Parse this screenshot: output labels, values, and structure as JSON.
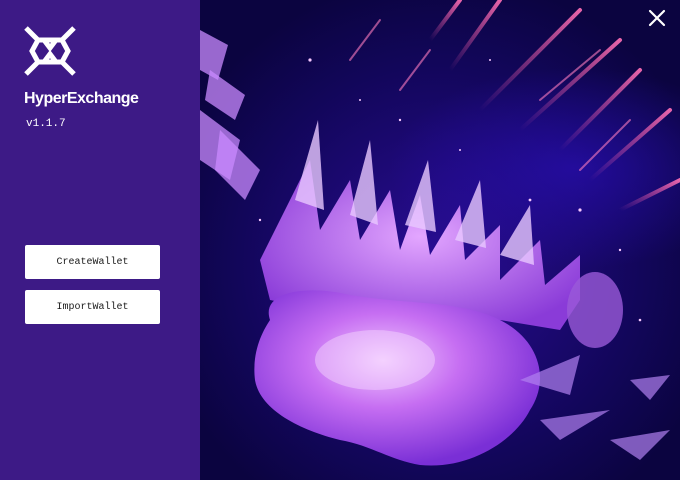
{
  "app": {
    "brand_name": "HyperExchange",
    "version": "v1.1.7"
  },
  "actions": {
    "create_wallet_label": "CreateWallet",
    "import_wallet_label": "ImportWallet"
  },
  "window": {
    "close_icon": "close-icon"
  },
  "colors": {
    "sidebar_bg": "#3d1a86",
    "hero_bg": "#1a0a5e",
    "button_bg": "#ffffff",
    "accent_pink": "#e0559a",
    "accent_violet": "#b26ce6"
  }
}
